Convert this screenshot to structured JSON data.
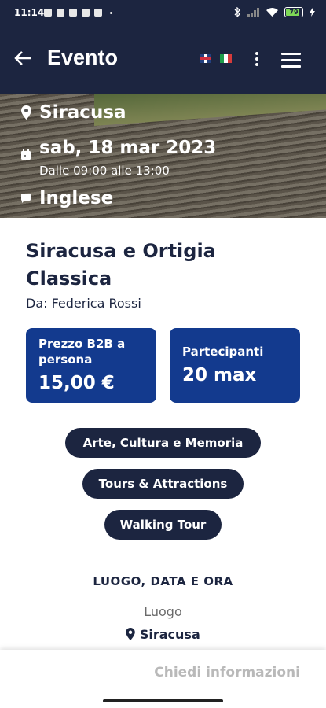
{
  "status_bar": {
    "time": "11:14",
    "battery": "79"
  },
  "app_bar": {
    "back_icon": "arrow-left-icon",
    "title": "Evento",
    "languages": [
      "en",
      "it"
    ]
  },
  "hero": {
    "city": "Siracusa",
    "date": "sab, 18 mar 2023",
    "hours": "Dalle 09:00 alle 13:00",
    "language": "Inglese"
  },
  "event": {
    "title": "Siracusa e Ortigia Classica",
    "author": "Da: Federica Rossi",
    "price_label": "Prezzo B2B a persona",
    "price_value": "15,00 €",
    "participants_label": "Partecipanti",
    "participants_value": "20 max",
    "tags": [
      "Arte, Cultura e Memoria",
      "Tours & Attractions",
      "Walking Tour"
    ]
  },
  "details": {
    "section_title": "LUOGO, DATA E ORA",
    "location_label": "Luogo",
    "location_value": "Siracusa"
  },
  "bottom": {
    "cta": "Chiedi informazioni"
  },
  "colors": {
    "navy": "#1c2540",
    "blue_card": "#133a8e",
    "cta_disabled": "#b9b9b9"
  }
}
